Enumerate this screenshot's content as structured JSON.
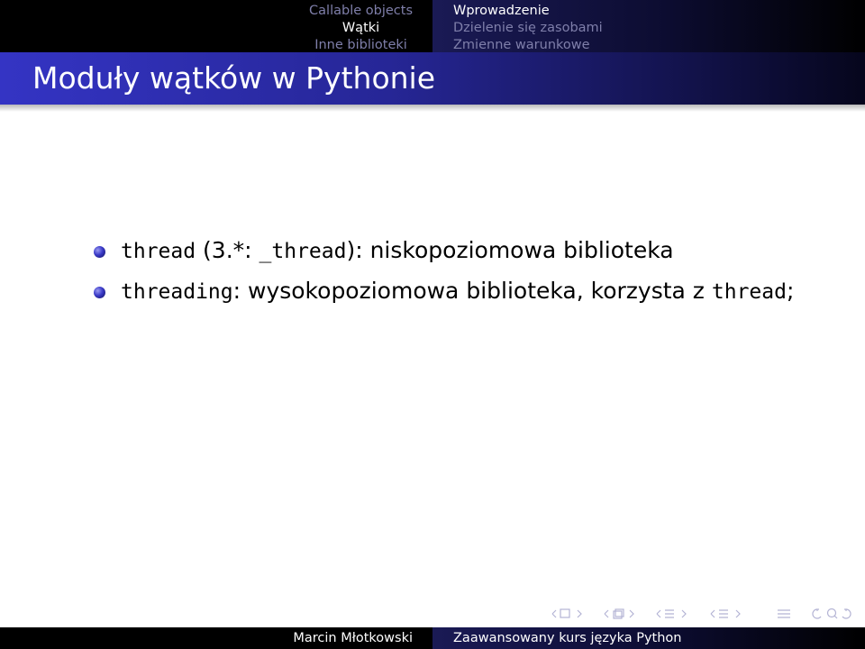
{
  "header": {
    "sections_left": [
      "Callable objects",
      "Wątki",
      "Inne biblioteki"
    ],
    "active_left": "Wątki",
    "subsections_right": [
      "Wprowadzenie",
      "Dzielenie się zasobami",
      "Zmienne warunkowe"
    ],
    "active_right": "Wprowadzenie"
  },
  "frame": {
    "title": "Moduły wątków w Pythonie"
  },
  "bullets": {
    "b1_code": "thread",
    "b1_paren_open": " (3.*: ",
    "b1_code2": "_thread",
    "b1_rest": "): niskopoziomowa biblioteka",
    "b2_code": "threading",
    "b2_rest": ": wysokopoziomowa biblioteka, korzysta z ",
    "b2_code2": "thread",
    "b2_end": ";"
  },
  "footer": {
    "author": "Marcin Młotkowski",
    "title": "Zaawansowany kurs języka Python"
  },
  "colors": {
    "nav_inactive": "#7f7faa",
    "title_bar": "#2c2ca8",
    "bullet_ball": "#3a3ac8"
  },
  "icons": [
    "nav-prev-slide-icon",
    "nav-next-slide-icon",
    "nav-frame-icon",
    "nav-section-icon",
    "nav-subsection-icon",
    "nav-doc-icon",
    "nav-search-icon"
  ]
}
